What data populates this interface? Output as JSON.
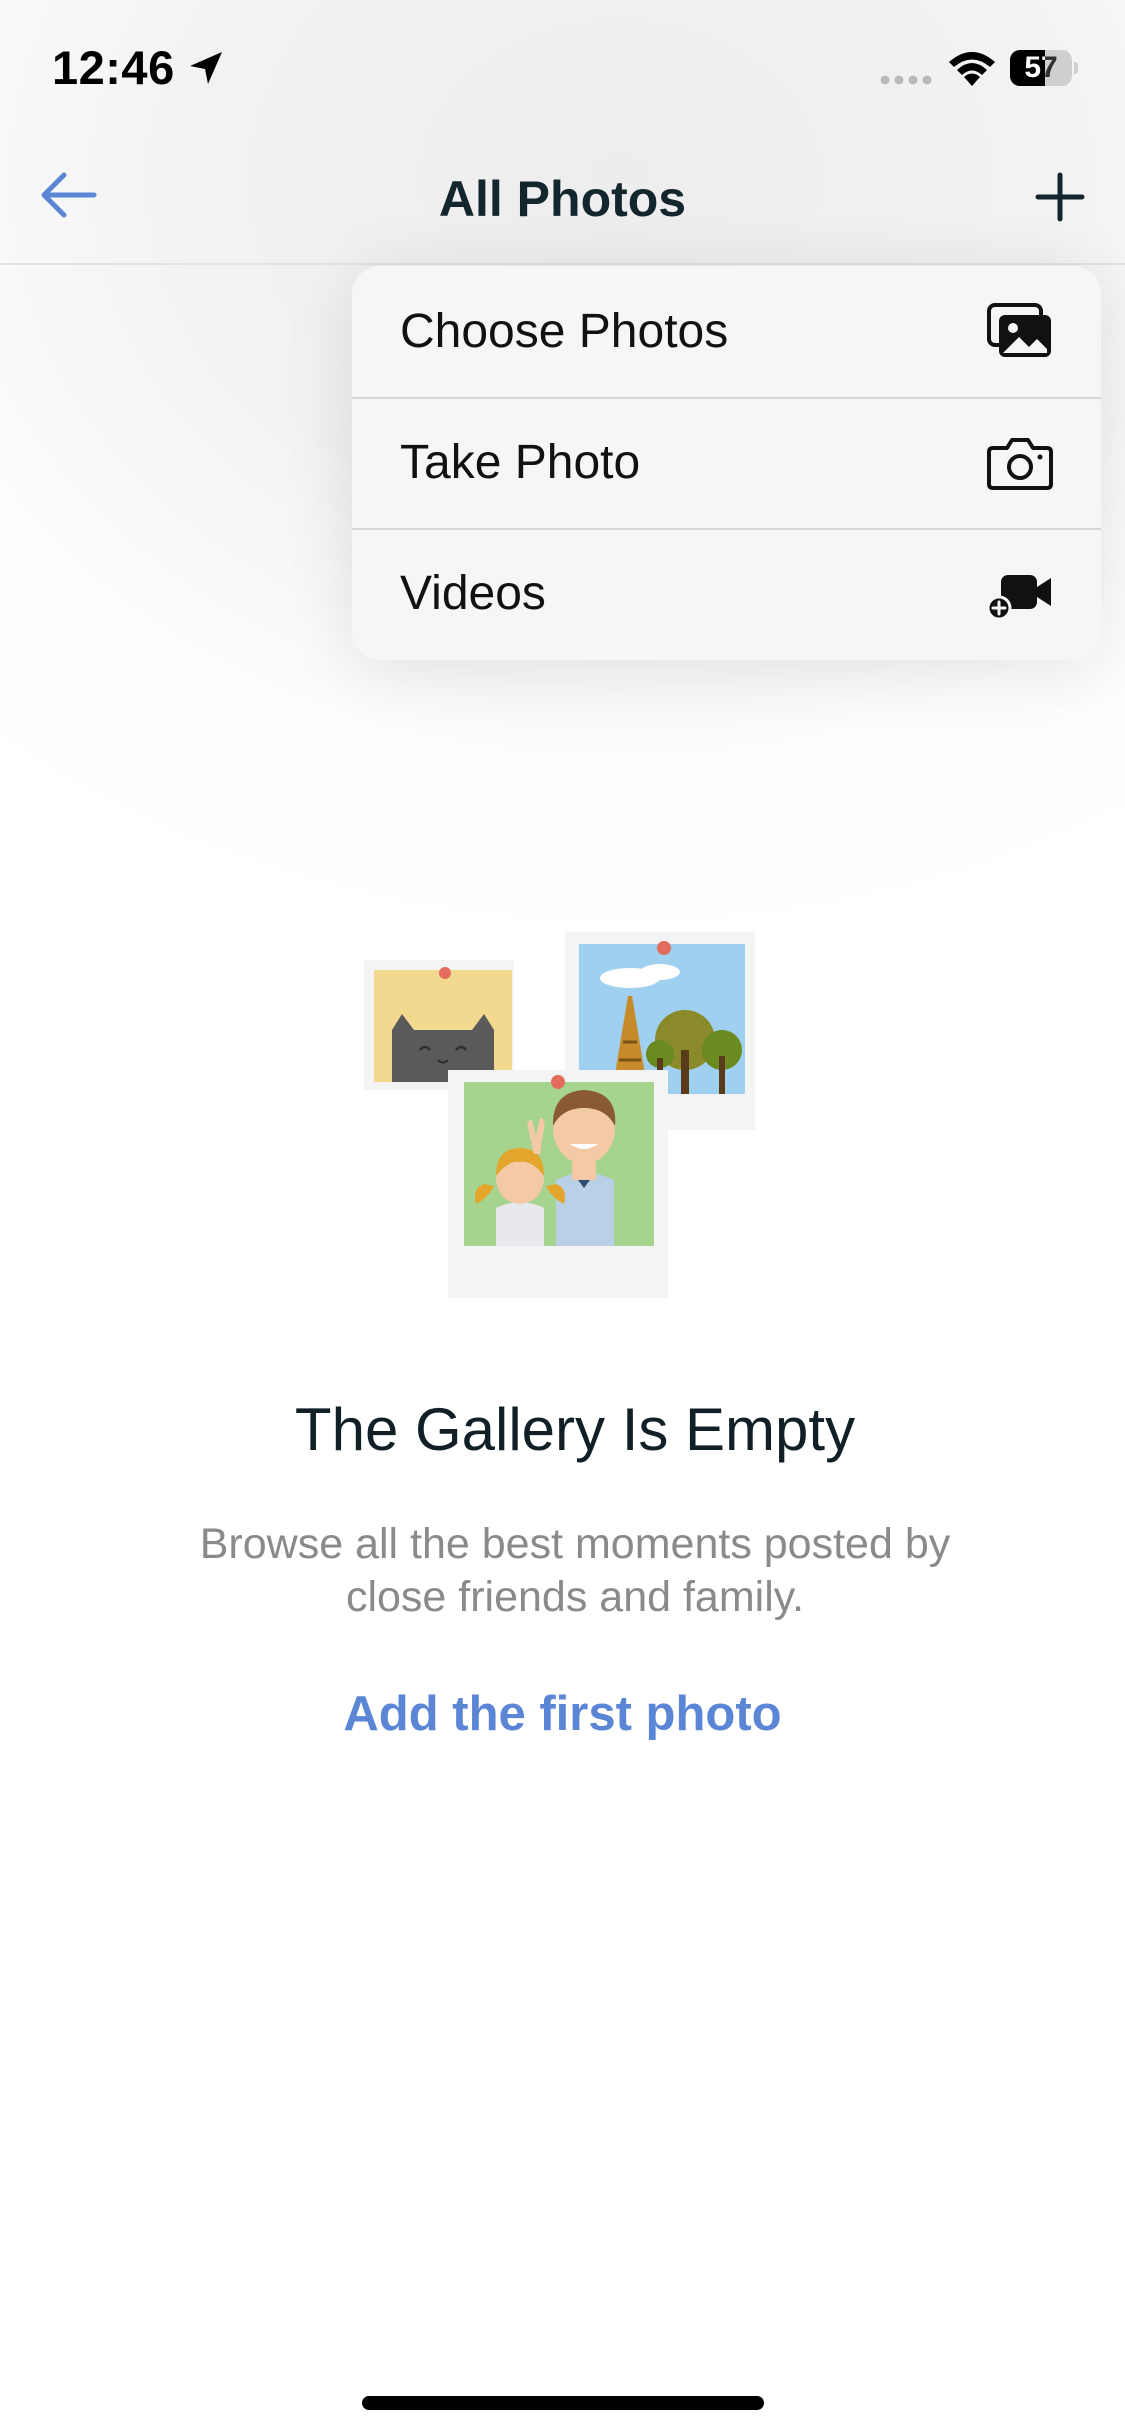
{
  "status_bar": {
    "time": "12:46",
    "battery_level": "57",
    "battery_fraction": 0.57
  },
  "nav": {
    "title": "All Photos",
    "back_icon": "arrow-left-icon",
    "add_icon": "plus-icon"
  },
  "menu": {
    "items": [
      {
        "label": "Choose Photos",
        "icon": "photo-gallery-icon"
      },
      {
        "label": "Take Photo",
        "icon": "camera-icon"
      },
      {
        "label": "Videos",
        "icon": "video-camera-add-icon"
      }
    ]
  },
  "empty_state": {
    "title": "The Gallery Is Empty",
    "description": "Browse all the best moments posted by close friends and family.",
    "link": "Add the first photo"
  },
  "colors": {
    "accent": "#5b86d6",
    "title": "#13262e",
    "muted": "#8a8a8a",
    "menu_bg": "#f6f6f6"
  }
}
